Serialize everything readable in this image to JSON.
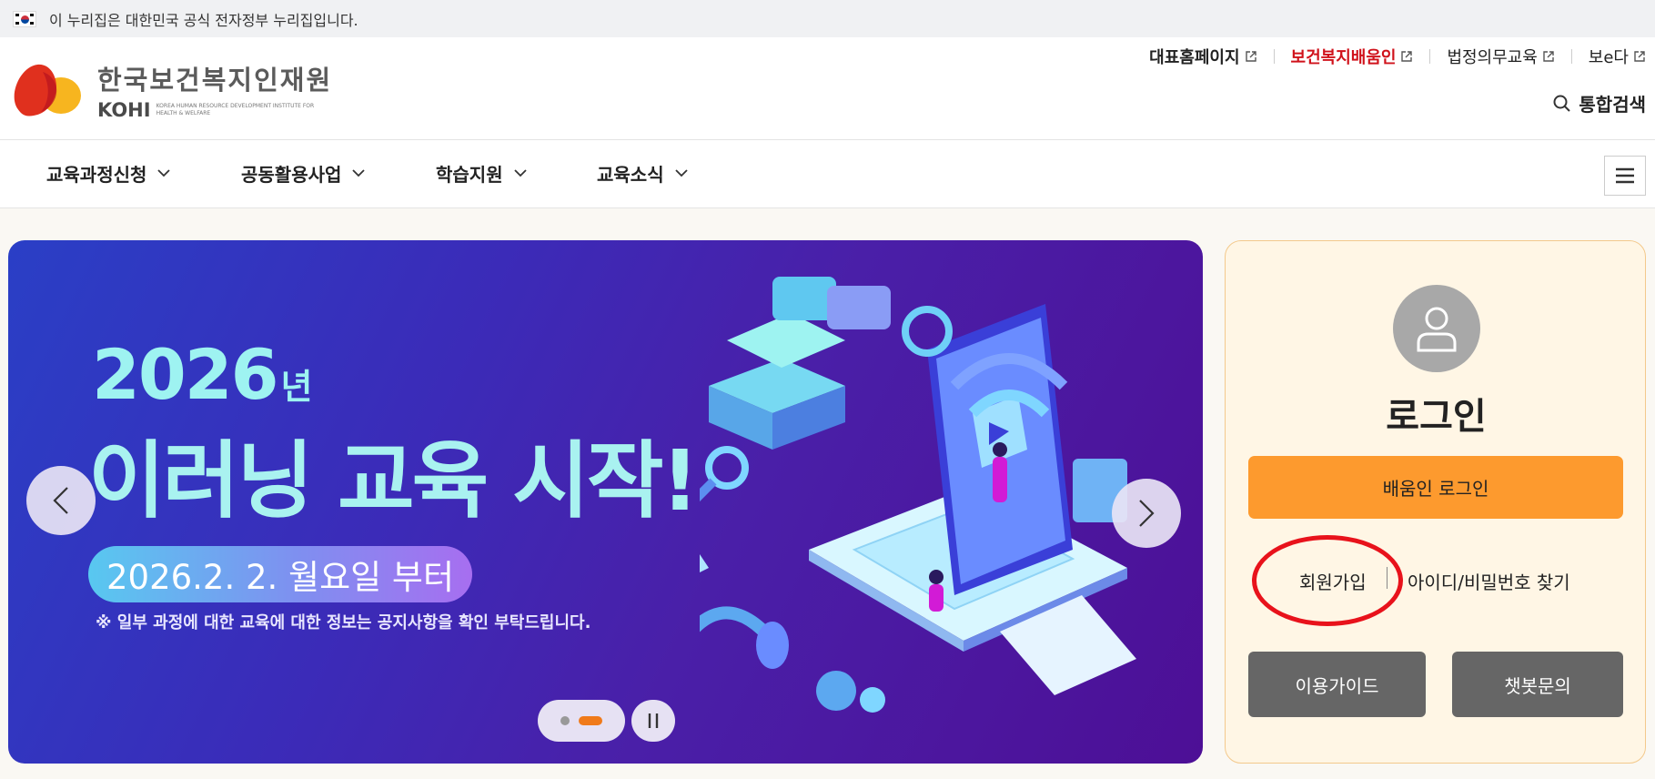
{
  "gov_banner": {
    "text": "이 누리집은 대한민국 공식 전자정부 누리집입니다."
  },
  "header": {
    "logo": {
      "ko": "한국보건복지인재원",
      "en": "KOHI",
      "sub": "KOREA HUMAN RESOURCE DEVELOPMENT INSTITUTE FOR HEALTH & WELFARE"
    },
    "top_links": [
      {
        "label": "대표홈페이지",
        "icon": "external-link-icon"
      },
      {
        "label": "보건복지배움인",
        "icon": "external-link-icon",
        "color": "#d0121b"
      },
      {
        "label": "법정의무교육",
        "icon": "external-link-icon"
      },
      {
        "label": "보e다",
        "icon": "external-link-icon"
      }
    ],
    "search_label": "통합검색"
  },
  "nav": {
    "items": [
      {
        "label": "교육과정신청",
        "icon": "chevron-down-icon"
      },
      {
        "label": "공동활용사업",
        "icon": "chevron-down-icon"
      },
      {
        "label": "학습지원",
        "icon": "chevron-down-icon"
      },
      {
        "label": "교육소식",
        "icon": "chevron-down-icon"
      }
    ],
    "menu_icon": "hamburger-icon"
  },
  "banner": {
    "year": "2026",
    "year_suffix": "년",
    "title": "이러닝 교육 시작!",
    "date": "2026.2. 2. 월요일 부터",
    "note": "※ 일부 과정에 대한 교육에 대한 정보는 공지사항을 확인 부탁드립니다.",
    "slide_current": 2,
    "slide_total": 2
  },
  "login": {
    "title": "로그인",
    "login_button": "배움인 로그인",
    "signup_link": "회원가입",
    "find_link": "아이디/비밀번호 찾기",
    "guide_button": "이용가이드",
    "chatbot_button": "챗봇문의"
  },
  "colors": {
    "accent_orange": "#fd9a2e",
    "brand_red": "#d0121b",
    "annotation_red": "#e8121b"
  }
}
